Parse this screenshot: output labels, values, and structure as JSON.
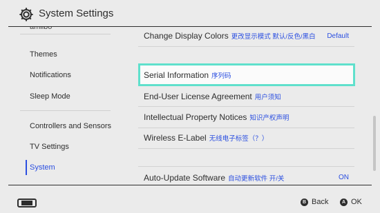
{
  "header": {
    "title": "System Settings"
  },
  "sidebar": {
    "items": [
      {
        "label": "amiibo"
      },
      {
        "label": "Themes"
      },
      {
        "label": "Notifications"
      },
      {
        "label": "Sleep Mode"
      },
      {
        "label": "Controllers and Sensors"
      },
      {
        "label": "TV Settings"
      },
      {
        "label": "System"
      }
    ],
    "selected": "System"
  },
  "content": {
    "rows": [
      {
        "label": "Change Display Colors",
        "cn": "更改显示模式 默认/反色/黑白",
        "value": "Default"
      },
      {
        "label": "Serial Information",
        "cn": "序列码",
        "value": ""
      },
      {
        "label": "End-User License Agreement",
        "cn": "用户须知",
        "value": ""
      },
      {
        "label": "Intellectual Property Notices",
        "cn": "知识产权声明",
        "value": ""
      },
      {
        "label": "Wireless E-Label",
        "cn": "无线电子标签（？）",
        "value": ""
      },
      {
        "label": "Auto-Update Software",
        "cn": "自动更新软件 开/关",
        "value": "ON"
      }
    ],
    "focused": "Serial Information"
  },
  "footer": {
    "back": {
      "key": "B",
      "label": "Back"
    },
    "ok": {
      "key": "A",
      "label": "OK"
    }
  },
  "colors": {
    "accent": "#2a4ee0",
    "focus": "#5fe0cc",
    "background": "#ebebeb"
  }
}
